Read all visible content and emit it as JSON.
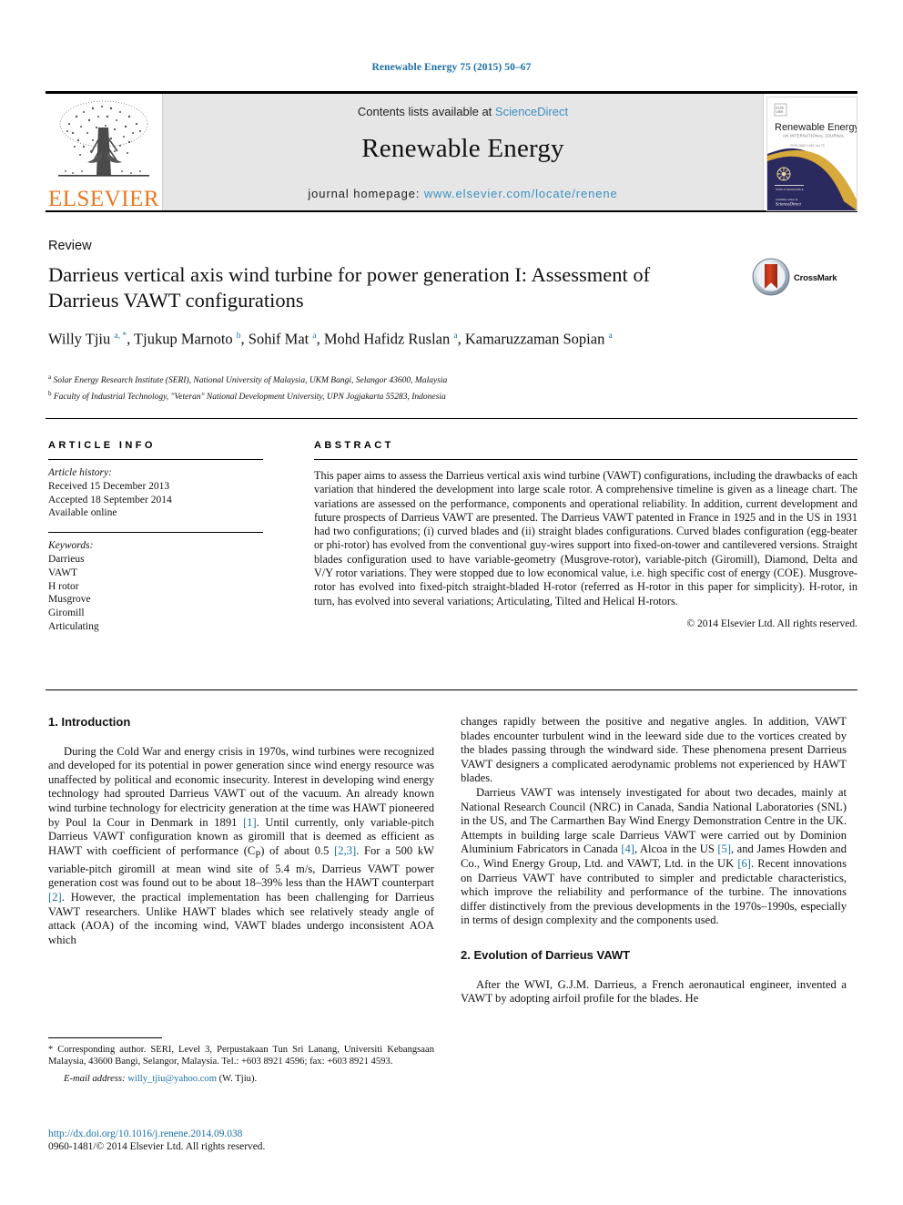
{
  "running_head": "Renewable Energy 75 (2015) 50–67",
  "masthead": {
    "contents_prefix": "Contents lists available at ",
    "sciencedirect": "ScienceDirect",
    "journal_title": "Renewable Energy",
    "homepage_prefix": "journal homepage: ",
    "homepage_url": "www.elsevier.com/locate/renene",
    "publisher": "ELSEVIER",
    "cover_title": "Renewable Energy",
    "cover_subtitle": "AN INTERNATIONAL JOURNAL",
    "accent_link_color": "#3a8fbf",
    "publisher_color": "#e87722"
  },
  "article": {
    "type": "Review",
    "title": "Darrieus vertical axis wind turbine for power generation I: Assessment of Darrieus VAWT configurations",
    "crossmark_label": "CrossMark",
    "authors_html": "Willy Tjiu <sup>a, *</sup>, Tjukup Marnoto <sup>b</sup>, Sohif Mat <sup>a</sup>, Mohd Hafidz Ruslan <sup>a</sup>, Kamaruzzaman Sopian <sup>a</sup>",
    "affiliation_a": "Solar Energy Research Institute (SERI), National University of Malaysia, UKM Bangi, Selangor 43600, Malaysia",
    "affiliation_b": "Faculty of Industrial Technology, \"Veteran\" National Development University, UPN Jogjakarta 55283, Indonesia"
  },
  "info": {
    "heading": "ARTICLE INFO",
    "history_label": "Article history:",
    "history": [
      "Received 15 December 2013",
      "Accepted 18 September 2014",
      "Available online"
    ],
    "keywords_label": "Keywords:",
    "keywords": [
      "Darrieus",
      "VAWT",
      "H rotor",
      "Musgrove",
      "Giromill",
      "Articulating"
    ]
  },
  "abstract": {
    "heading": "ABSTRACT",
    "text": "This paper aims to assess the Darrieus vertical axis wind turbine (VAWT) configurations, including the drawbacks of each variation that hindered the development into large scale rotor. A comprehensive timeline is given as a lineage chart. The variations are assessed on the performance, components and operational reliability. In addition, current development and future prospects of Darrieus VAWT are presented. The Darrieus VAWT patented in France in 1925 and in the US in 1931 had two configurations; (i) curved blades and (ii) straight blades configurations. Curved blades configuration (egg-beater or phi-rotor) has evolved from the conventional guy-wires support into fixed-on-tower and cantilevered versions. Straight blades configuration used to have variable-geometry (Musgrove-rotor), variable-pitch (Giromill), Diamond, Delta and V/Y rotor variations. They were stopped due to low economical value, i.e. high specific cost of energy (COE). Musgrove-rotor has evolved into fixed-pitch straight-bladed H-rotor (referred as H-rotor in this paper for simplicity). H-rotor, in turn, has evolved into several variations; Articulating, Tilted and Helical H-rotors.",
    "copyright": "© 2014 Elsevier Ltd. All rights reserved."
  },
  "body": {
    "section1_title": "1. Introduction",
    "section2_title": "2. Evolution of Darrieus VAWT",
    "left_p1_a": "During the Cold War and energy crisis in 1970s, wind turbines were recognized and developed for its potential in power generation since wind energy resource was unaffected by political and economic insecurity. Interest in developing wind energy technology had sprouted Darrieus VAWT out of the vacuum. An already known wind turbine technology for electricity generation at the time was HAWT pioneered by Poul la Cour in Denmark in 1891 ",
    "ref1": "[1]",
    "left_p1_b": ". Until currently, only variable-pitch Darrieus VAWT configuration known as giromill that is deemed as efficient as HAWT with coefficient of performance (C",
    "cp_sub": "P",
    "left_p1_c": ") of about 0.5 ",
    "ref23": "[2,3]",
    "left_p1_d": ". For a 500 kW variable-pitch giromill at mean wind site of 5.4 m/s, Darrieus VAWT power generation cost was found out to be about 18–39% less than the HAWT counterpart ",
    "ref2": "[2]",
    "left_p1_e": ". However, the practical implementation has been challenging for Darrieus VAWT researchers. Unlike HAWT blades which see relatively steady angle of attack (AOA) of the incoming wind, VAWT blades undergo inconsistent AOA which",
    "right_p1": "changes rapidly between the positive and negative angles. In addition, VAWT blades encounter turbulent wind in the leeward side due to the vortices created by the blades passing through the windward side. These phenomena present Darrieus VAWT designers a complicated aerodynamic problems not experienced by HAWT blades.",
    "right_p2_a": "Darrieus VAWT was intensely investigated for about two decades, mainly at National Research Council (NRC) in Canada, Sandia National Laboratories (SNL) in the US, and The Carmarthen Bay Wind Energy Demonstration Centre in the UK. Attempts in building large scale Darrieus VAWT were carried out by Dominion Aluminium Fabricators in Canada ",
    "ref4": "[4]",
    "right_p2_b": ", Alcoa in the US ",
    "ref5": "[5]",
    "right_p2_c": ", and James Howden and Co., Wind Energy Group, Ltd. and VAWT, Ltd. in the UK ",
    "ref6": "[6]",
    "right_p2_d": ". Recent innovations on Darrieus VAWT have contributed to simpler and predictable characteristics, which improve the reliability and performance of the turbine. The innovations differ distinctively from the previous developments in the 1970s–1990s, especially in terms of design complexity and the components used.",
    "right_p3": "After the WWI, G.J.M. Darrieus, a French aeronautical engineer, invented a VAWT by adopting airfoil profile for the blades. He"
  },
  "footnotes": {
    "corresponding": "* Corresponding author. SERI, Level 3, Perpustakaan Tun Sri Lanang, Universiti Kebangsaan Malaysia, 43600 Bangi, Selangor, Malaysia. Tel.: +603 8921 4596; fax: +603 8921 4593.",
    "email_label": "E-mail address:",
    "email": "willy_tjiu@yahoo.com",
    "email_suffix": "(W. Tjiu).",
    "doi": "http://dx.doi.org/10.1016/j.renene.2014.09.038",
    "issn_line": "0960-1481/© 2014 Elsevier Ltd. All rights reserved."
  }
}
